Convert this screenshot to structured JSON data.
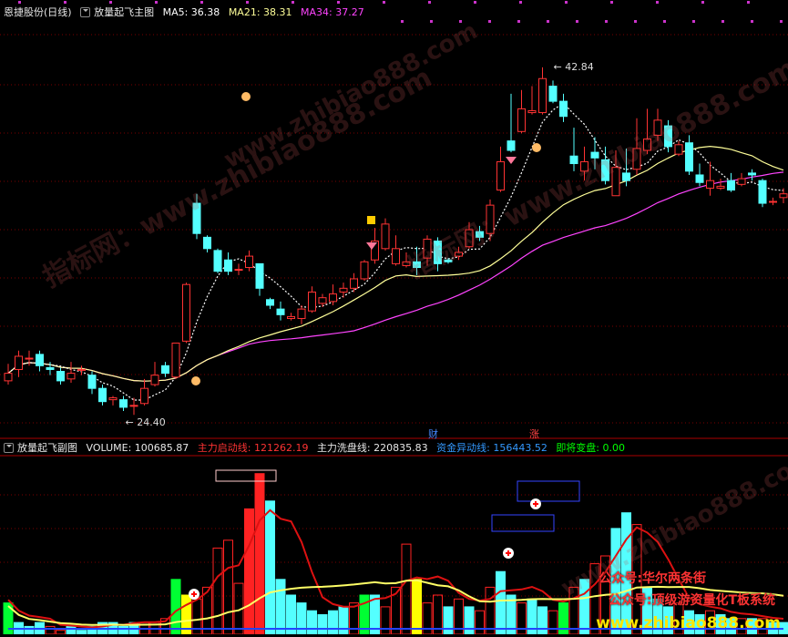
{
  "header": {
    "stock": "恩捷股份",
    "period": "(日线)",
    "indicator": "放量起飞主图",
    "ma5": "MA5: 36.38",
    "ma21": "MA21: 38.31",
    "ma34": "MA34: 37.27"
  },
  "sub_header": {
    "indicator": "放量起飞副图",
    "volume": "VOLUME: 100685.87",
    "start_line": "主力启动线: 121262.19",
    "wash_line": "主力洗盘线: 220835.83",
    "fund_line": "资金异动线: 156443.52",
    "change": "即将变盘: 0.00"
  },
  "markers": {
    "cai": "财",
    "zhang": "涨"
  },
  "watermarks": [
    "www.zhibiao888.com",
    "指标网：www.zhibiao888.com",
    "指标网：www.zhibiao888.com",
    "www.zhibiao888.com"
  ],
  "promo": {
    "line1": "公众号:华尔两条街",
    "line2": "公众号:顶级游资量化T板系统",
    "site": "www.zhibiao888.com"
  },
  "colors": {
    "up": "#ff3333",
    "down": "#54ffff",
    "ma5": "#ffffff",
    "ma21": "#ffff99",
    "ma34": "#ff44ff"
  },
  "chart_data": {
    "type": "candlestick",
    "price_range": [
      23.3,
      45.3
    ],
    "annotations": {
      "high": "42.84",
      "low": "24.40"
    },
    "candles": [
      [
        26.2,
        26.6,
        26.0,
        27.1
      ],
      [
        26.8,
        27.5,
        26.4,
        27.8
      ],
      [
        27.4,
        27.4,
        27.0,
        27.8
      ],
      [
        27.6,
        27.0,
        26.7,
        27.8
      ],
      [
        26.9,
        26.8,
        26.5,
        27.2
      ],
      [
        26.7,
        26.2,
        26.0,
        26.9
      ],
      [
        26.3,
        26.6,
        26.1,
        27.2
      ],
      [
        26.8,
        26.8,
        26.5,
        27.0
      ],
      [
        26.5,
        25.8,
        25.5,
        26.7
      ],
      [
        25.8,
        25.1,
        24.9,
        26.0
      ],
      [
        25.2,
        25.3,
        24.9,
        25.4
      ],
      [
        25.2,
        24.8,
        24.6,
        25.4
      ],
      [
        24.9,
        24.9,
        24.4,
        25.3
      ],
      [
        25.0,
        25.8,
        24.9,
        26.3
      ],
      [
        26.0,
        26.5,
        25.9,
        27.2
      ],
      [
        27.0,
        26.6,
        26.4,
        27.2
      ],
      [
        26.4,
        28.2,
        26.3,
        28.2
      ],
      [
        28.3,
        31.3,
        28.2,
        31.4
      ],
      [
        35.6,
        34.0,
        33.7,
        36.1
      ],
      [
        33.8,
        33.2,
        33.0,
        33.9
      ],
      [
        33.1,
        32.0,
        31.9,
        33.2
      ],
      [
        32.6,
        32.0,
        31.8,
        33.0
      ],
      [
        32.1,
        32.1,
        31.8,
        32.4
      ],
      [
        32.2,
        32.8,
        32.0,
        33.1
      ],
      [
        32.4,
        31.1,
        30.7,
        32.4
      ],
      [
        30.5,
        30.2,
        30.0,
        30.6
      ],
      [
        30.0,
        29.7,
        29.4,
        30.4
      ],
      [
        29.5,
        29.6,
        29.4,
        29.8
      ],
      [
        29.5,
        30.0,
        29.2,
        30.2
      ],
      [
        29.9,
        30.9,
        29.8,
        31.2
      ],
      [
        30.3,
        30.6,
        30.1,
        30.8
      ],
      [
        30.4,
        30.8,
        30.2,
        31.3
      ],
      [
        30.9,
        31.1,
        30.6,
        31.4
      ],
      [
        31.1,
        31.6,
        30.9,
        31.9
      ],
      [
        31.6,
        32.5,
        31.5,
        32.6
      ],
      [
        32.6,
        33.6,
        32.4,
        34.3
      ],
      [
        33.2,
        34.5,
        33.1,
        34.8
      ],
      [
        32.4,
        33.2,
        32.3,
        33.9
      ],
      [
        32.3,
        32.5,
        32.2,
        33.0
      ],
      [
        32.5,
        32.2,
        31.8,
        33.3
      ],
      [
        32.7,
        33.7,
        32.3,
        33.9
      ],
      [
        33.6,
        32.4,
        32.0,
        33.8
      ],
      [
        32.6,
        32.5,
        32.4,
        32.7
      ],
      [
        32.8,
        33.0,
        32.6,
        33.3
      ],
      [
        33.3,
        34.2,
        33.2,
        34.6
      ],
      [
        34.1,
        33.8,
        33.6,
        34.4
      ],
      [
        34.0,
        35.5,
        33.6,
        35.8
      ],
      [
        36.3,
        37.8,
        36.2,
        38.6
      ],
      [
        38.9,
        38.4,
        38.3,
        41.4
      ],
      [
        39.4,
        40.6,
        39.3,
        41.6
      ],
      [
        40.4,
        40.5,
        40.3,
        41.8
      ],
      [
        40.4,
        42.2,
        40.3,
        42.8
      ],
      [
        41.8,
        41.0,
        40.9,
        42.1
      ],
      [
        41.0,
        40.2,
        39.9,
        41.4
      ],
      [
        38.1,
        37.7,
        37.3,
        39.6
      ],
      [
        37.3,
        37.8,
        36.8,
        38.6
      ],
      [
        38.3,
        38.0,
        37.4,
        39.1
      ],
      [
        37.9,
        36.8,
        36.6,
        38.6
      ],
      [
        36.0,
        37.5,
        36.2,
        38.4
      ],
      [
        37.2,
        36.8,
        36.5,
        38.5
      ],
      [
        37.4,
        38.5,
        37.1,
        40.1
      ],
      [
        38.4,
        39.0,
        38.2,
        40.6
      ],
      [
        39.2,
        40.0,
        38.9,
        40.6
      ],
      [
        39.7,
        38.6,
        38.3,
        40.0
      ],
      [
        38.2,
        38.7,
        38.1,
        38.9
      ],
      [
        38.8,
        37.3,
        37.1,
        39.2
      ],
      [
        37.1,
        36.7,
        36.5,
        37.7
      ],
      [
        36.4,
        36.8,
        36.0,
        37.8
      ],
      [
        36.4,
        36.5,
        36.3,
        36.9
      ],
      [
        36.8,
        36.3,
        36.2,
        37.2
      ],
      [
        36.6,
        36.9,
        36.5,
        37.2
      ],
      [
        37.2,
        37.1,
        36.8,
        37.4
      ],
      [
        36.8,
        35.6,
        35.4,
        36.9
      ],
      [
        35.7,
        35.7,
        35.5,
        35.9
      ],
      [
        35.9,
        36.1,
        35.6,
        36.4
      ]
    ],
    "volume_bars": [
      [
        0,
        8,
        "lime"
      ],
      [
        1,
        3,
        "cyan"
      ],
      [
        2,
        2,
        "cyan"
      ],
      [
        3,
        3,
        "cyan"
      ],
      [
        4,
        2,
        "red"
      ],
      [
        5,
        1,
        "red"
      ],
      [
        6,
        2,
        "cyan"
      ],
      [
        7,
        1,
        "cyan"
      ],
      [
        8,
        2,
        "cyan"
      ],
      [
        9,
        3,
        "cyan"
      ],
      [
        10,
        3,
        "cyan"
      ],
      [
        11,
        2,
        "cyan"
      ],
      [
        12,
        3,
        "cyan"
      ],
      [
        13,
        3,
        "red"
      ],
      [
        14,
        3,
        "red"
      ],
      [
        15,
        4,
        "red"
      ],
      [
        16,
        14,
        "lime"
      ],
      [
        17,
        10,
        "yellow"
      ],
      [
        18,
        9,
        "red"
      ],
      [
        19,
        12,
        "red"
      ],
      [
        20,
        22,
        "red"
      ],
      [
        21,
        24,
        "red"
      ],
      [
        22,
        13,
        "red"
      ],
      [
        23,
        32,
        "red"
      ],
      [
        24,
        41,
        "red"
      ],
      [
        25,
        34,
        "cyan"
      ],
      [
        26,
        14,
        "cyan"
      ],
      [
        27,
        10,
        "cyan"
      ],
      [
        28,
        8,
        "cyan"
      ],
      [
        29,
        6,
        "cyan"
      ],
      [
        30,
        5,
        "cyan"
      ],
      [
        31,
        6,
        "cyan"
      ],
      [
        32,
        7,
        "cyan"
      ],
      [
        33,
        8,
        "red"
      ],
      [
        34,
        10,
        "lime"
      ],
      [
        35,
        10,
        "cyan"
      ],
      [
        36,
        7,
        "red"
      ],
      [
        37,
        12,
        "red"
      ],
      [
        38,
        23,
        "red"
      ],
      [
        39,
        14,
        "yellow"
      ],
      [
        40,
        8,
        "red"
      ],
      [
        41,
        10,
        "red"
      ],
      [
        42,
        7,
        "cyan"
      ],
      [
        43,
        9,
        "red"
      ],
      [
        44,
        7,
        "cyan"
      ],
      [
        45,
        6,
        "red"
      ],
      [
        46,
        12,
        "red"
      ],
      [
        47,
        16,
        "cyan"
      ],
      [
        48,
        10,
        "cyan"
      ],
      [
        49,
        8,
        "red"
      ],
      [
        50,
        9,
        "cyan"
      ],
      [
        51,
        7,
        "cyan"
      ],
      [
        52,
        6,
        "red"
      ],
      [
        53,
        8,
        "lime"
      ],
      [
        54,
        12,
        "red"
      ],
      [
        55,
        14,
        "cyan"
      ],
      [
        56,
        18,
        "red"
      ],
      [
        57,
        20,
        "red"
      ],
      [
        58,
        27,
        "cyan"
      ],
      [
        59,
        31,
        "cyan"
      ],
      [
        60,
        28,
        "red"
      ],
      [
        61,
        12,
        "cyan"
      ],
      [
        62,
        9,
        "cyan"
      ],
      [
        63,
        7,
        "cyan"
      ],
      [
        64,
        8,
        "red"
      ],
      [
        65,
        6,
        "cyan"
      ],
      [
        66,
        5,
        "cyan"
      ],
      [
        67,
        6,
        "red"
      ],
      [
        68,
        5,
        "cyan"
      ],
      [
        69,
        4,
        "cyan"
      ],
      [
        70,
        4,
        "red"
      ],
      [
        71,
        4,
        "cyan"
      ],
      [
        72,
        4,
        "red"
      ],
      [
        73,
        3,
        "cyan"
      ],
      [
        74,
        3,
        "cyan"
      ]
    ]
  }
}
